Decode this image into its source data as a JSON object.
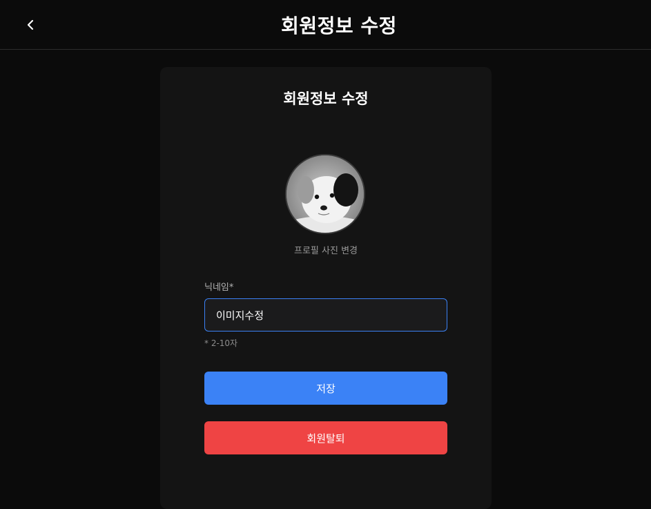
{
  "header": {
    "title": "회원정보 수정",
    "back_icon": "chevron-left-icon"
  },
  "card": {
    "title": "회원정보 수정",
    "avatar_caption": "프로필 사진 변경",
    "nickname": {
      "label": "닉네임*",
      "value": "이미지수정",
      "hint": "* 2-10자"
    },
    "save_label": "저장",
    "withdraw_label": "회원탈퇴"
  },
  "colors": {
    "background": "#0b0b0b",
    "card": "#141414",
    "primary": "#3b82f6",
    "danger": "#ef4444"
  }
}
